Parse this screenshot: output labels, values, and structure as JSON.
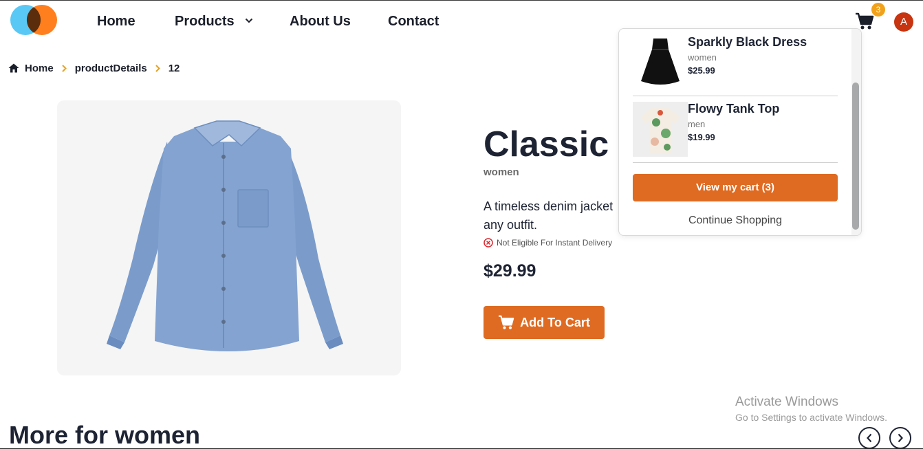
{
  "navbar": {
    "links": [
      "Home",
      "Products",
      "About Us",
      "Contact"
    ],
    "cart_count": "3",
    "avatar_initial": "A"
  },
  "breadcrumb": {
    "items": [
      "Home",
      "productDetails",
      "12"
    ]
  },
  "product": {
    "title": "Classic D",
    "category": "women",
    "description": "A timeless denim jacket any outfit.",
    "delivery_status": "Not Eligible For Instant Delivery",
    "price": "$29.99",
    "add_to_cart_label": "Add To Cart"
  },
  "cart_dropdown": {
    "items": [
      {
        "name": "Sparkly Black Dress",
        "category": "women",
        "price": "$25.99"
      },
      {
        "name": "Flowy Tank Top",
        "category": "men",
        "price": "$19.99"
      }
    ],
    "view_cart_label": "View my cart (3)",
    "continue_label": "Continue Shopping"
  },
  "related": {
    "heading": "More for women"
  },
  "watermark": {
    "title": "Activate Windows",
    "subtitle": "Go to Settings to activate Windows."
  },
  "colors": {
    "accent": "#df6b22",
    "badge": "#f1a21a",
    "avatar": "#c7340f",
    "breadcrumb_separator": "#e9a11d",
    "logo_left": "#5ac8f5",
    "logo_right": "#ff7f1f"
  }
}
